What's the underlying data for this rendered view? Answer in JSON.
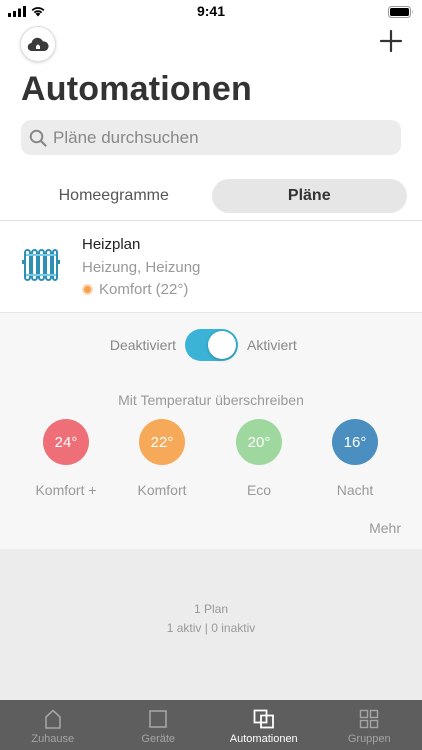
{
  "status_bar": {
    "time": "9:41"
  },
  "header": {
    "title": "Automationen"
  },
  "search": {
    "placeholder": "Pläne durchsuchen"
  },
  "segments": [
    {
      "label": "Homeegramme",
      "active": false
    },
    {
      "label": "Pläne",
      "active": true
    }
  ],
  "plan": {
    "name": "Heizplan",
    "subtitle": "Heizung, Heizung",
    "mode": "Komfort (22°)",
    "mode_color": "#f5a04e"
  },
  "toggle": {
    "off_label": "Deaktiviert",
    "on_label": "Aktiviert",
    "enabled": true,
    "color": "#3ab3d6"
  },
  "override": {
    "title": "Mit Temperatur überschreiben",
    "presets": [
      {
        "value": "24°",
        "label": "Komfort +",
        "color": "#ef6f78"
      },
      {
        "value": "22°",
        "label": "Komfort",
        "color": "#f6a958"
      },
      {
        "value": "20°",
        "label": "Eco",
        "color": "#9fd89f"
      },
      {
        "value": "16°",
        "label": "Nacht",
        "color": "#4a8fc0"
      }
    ],
    "more_label": "Mehr"
  },
  "summary": {
    "plans": "1 Plan",
    "active_inactive": "1 aktiv | 0 inaktiv"
  },
  "tabs": [
    {
      "label": "Zuhause",
      "icon": "house-icon",
      "active": false
    },
    {
      "label": "Geräte",
      "icon": "square-icon",
      "active": false
    },
    {
      "label": "Automationen",
      "icon": "overlapping-squares-icon",
      "active": true
    },
    {
      "label": "Gruppen",
      "icon": "grid-icon",
      "active": false
    }
  ]
}
